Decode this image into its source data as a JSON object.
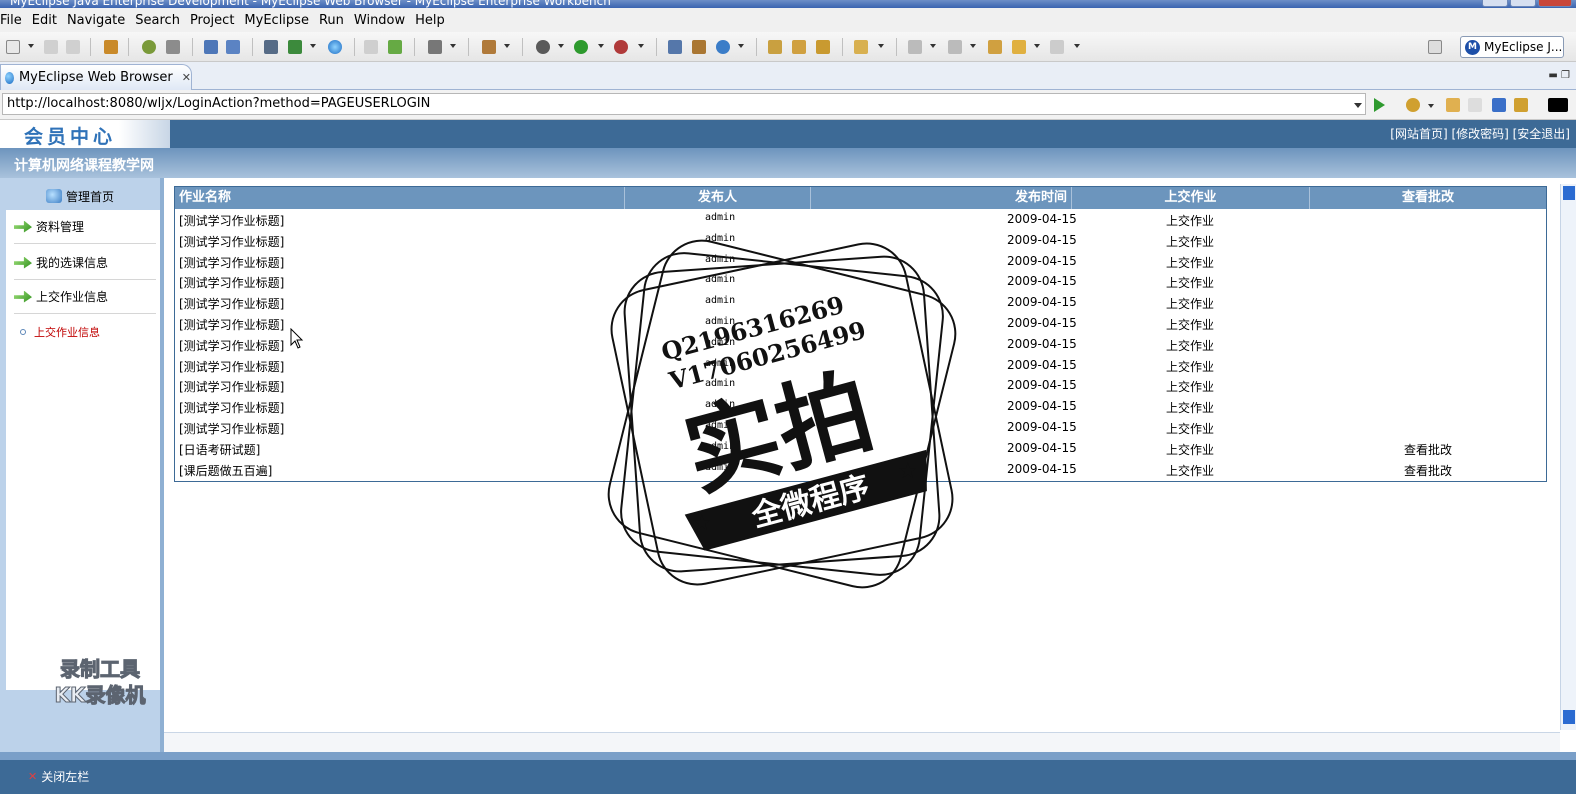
{
  "window": {
    "title": "MyEclipse Java Enterprise Development - MyEclipse Web Browser - MyEclipse Enterprise Workbench"
  },
  "menu": [
    "File",
    "Edit",
    "Navigate",
    "Search",
    "Project",
    "MyEclipse",
    "Run",
    "Window",
    "Help"
  ],
  "toolbar": {
    "perspective_label": "MyEclipse J..."
  },
  "editor_tab": {
    "label": "MyEclipse Web Browser"
  },
  "address": {
    "url": "http://localhost:8080/wljx/LoginAction?method=PAGEUSERLOGIN"
  },
  "site": {
    "logo": "会员中心",
    "top_links": "[网站首页] [修改密码] [安全退出]",
    "name": "计算机网络课程教学网"
  },
  "sidebar": {
    "home": "管理首页",
    "items": [
      {
        "label": "资料管理"
      },
      {
        "label": "我的选课信息"
      },
      {
        "label": "上交作业信息"
      }
    ],
    "subitem": "上交作业信息",
    "close_left": "关闭左栏"
  },
  "table": {
    "headers": [
      "作业名称",
      "发布人",
      "发布时间",
      "上交作业",
      "查看批改"
    ],
    "rows": [
      {
        "name": "[测试学习作业标题]",
        "publisher": "admin",
        "date": "2009-04-15",
        "submit": "上交作业",
        "review": ""
      },
      {
        "name": "[测试学习作业标题]",
        "publisher": "admin",
        "date": "2009-04-15",
        "submit": "上交作业",
        "review": ""
      },
      {
        "name": "[测试学习作业标题]",
        "publisher": "admin",
        "date": "2009-04-15",
        "submit": "上交作业",
        "review": ""
      },
      {
        "name": "[测试学习作业标题]",
        "publisher": "admin",
        "date": "2009-04-15",
        "submit": "上交作业",
        "review": ""
      },
      {
        "name": "[测试学习作业标题]",
        "publisher": "admin",
        "date": "2009-04-15",
        "submit": "上交作业",
        "review": ""
      },
      {
        "name": "[测试学习作业标题]",
        "publisher": "admin",
        "date": "2009-04-15",
        "submit": "上交作业",
        "review": ""
      },
      {
        "name": "[测试学习作业标题]",
        "publisher": "admin",
        "date": "2009-04-15",
        "submit": "上交作业",
        "review": ""
      },
      {
        "name": "[测试学习作业标题]",
        "publisher": "admin",
        "date": "2009-04-15",
        "submit": "上交作业",
        "review": ""
      },
      {
        "name": "[测试学习作业标题]",
        "publisher": "admin",
        "date": "2009-04-15",
        "submit": "上交作业",
        "review": ""
      },
      {
        "name": "[测试学习作业标题]",
        "publisher": "admin",
        "date": "2009-04-15",
        "submit": "上交作业",
        "review": ""
      },
      {
        "name": "[测试学习作业标题]",
        "publisher": "admin",
        "date": "2009-04-15",
        "submit": "上交作业",
        "review": ""
      },
      {
        "name": "[日语考研试题]",
        "publisher": "admin",
        "date": "2009-04-15",
        "submit": "上交作业",
        "review": "查看批改"
      },
      {
        "name": "[课后题做五百遍]",
        "publisher": "admin",
        "date": "2009-04-15",
        "submit": "上交作业",
        "review": "查看批改"
      }
    ]
  },
  "overlay_stamp": {
    "line1": "Q2196316269",
    "line2": "V17060256499",
    "big": "实拍",
    "banner": "全微程序"
  },
  "recorder_watermark": {
    "line1": "录制工具",
    "line2": "KK录像机"
  },
  "colors": {
    "header_blue": "#3d6a96",
    "grid_header": "#6c95bd",
    "sidebar_bg": "#bcd2ea",
    "active_red": "#c00000"
  }
}
